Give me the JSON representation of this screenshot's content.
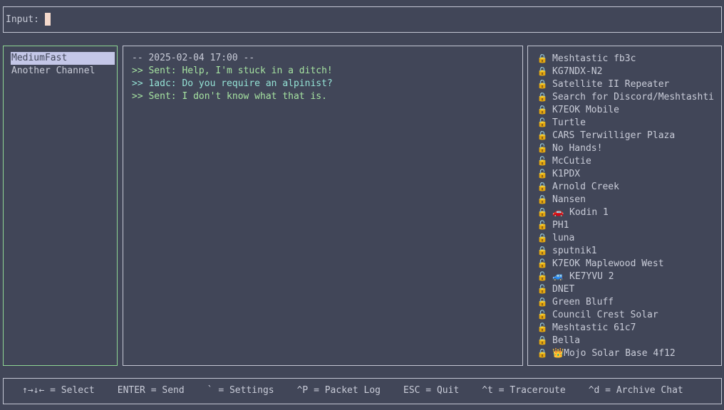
{
  "input": {
    "label": "Input:",
    "value": ""
  },
  "channels": [
    {
      "name": "MediumFast",
      "selected": true
    },
    {
      "name": "Another Channel",
      "selected": false
    }
  ],
  "messages": [
    {
      "type": "date",
      "text": "-- 2025-02-04 17:00 --"
    },
    {
      "type": "sent",
      "text": ">> Sent: Help, I'm stuck in a ditch!"
    },
    {
      "type": "recv",
      "text": ">> 1adc: Do you require an alpinist?"
    },
    {
      "type": "sent",
      "text": ">> Sent: I don't know what that is."
    }
  ],
  "icons": {
    "locked": "🔒",
    "unlocked": "🔓"
  },
  "nodes": [
    {
      "name": "Meshtastic fb3c",
      "lock": "locked"
    },
    {
      "name": "KG7NDX-N2",
      "lock": "locked"
    },
    {
      "name": "Satellite II Repeater",
      "lock": "locked"
    },
    {
      "name": "Search for Discord/Meshtashti",
      "lock": "locked"
    },
    {
      "name": "K7EOK Mobile",
      "lock": "locked"
    },
    {
      "name": "Turtle",
      "lock": "unlocked"
    },
    {
      "name": "CARS Terwilliger Plaza",
      "lock": "locked"
    },
    {
      "name": "No Hands!",
      "lock": "unlocked"
    },
    {
      "name": "McCutie",
      "lock": "unlocked"
    },
    {
      "name": "K1PDX",
      "lock": "unlocked"
    },
    {
      "name": "Arnold Creek",
      "lock": "locked"
    },
    {
      "name": "Nansen",
      "lock": "locked"
    },
    {
      "name": "🚗 Kodin 1",
      "lock": "locked"
    },
    {
      "name": "PH1",
      "lock": "unlocked"
    },
    {
      "name": "luna",
      "lock": "locked"
    },
    {
      "name": "sputnik1",
      "lock": "locked"
    },
    {
      "name": "K7EOK Maplewood West",
      "lock": "unlocked"
    },
    {
      "name": "🚙 KE7YVU 2",
      "lock": "unlocked"
    },
    {
      "name": "DNET",
      "lock": "unlocked"
    },
    {
      "name": "Green Bluff",
      "lock": "locked"
    },
    {
      "name": "Council Crest Solar",
      "lock": "unlocked"
    },
    {
      "name": "Meshtastic 61c7",
      "lock": "unlocked"
    },
    {
      "name": "Bella",
      "lock": "locked"
    },
    {
      "name": "👑Mojo Solar Base 4f12",
      "lock": "locked"
    }
  ],
  "footer": [
    "↑→↓← = Select",
    "ENTER = Send",
    "` = Settings",
    "^P = Packet Log",
    "ESC = Quit",
    "^t = Traceroute",
    "^d = Archive Chat"
  ]
}
